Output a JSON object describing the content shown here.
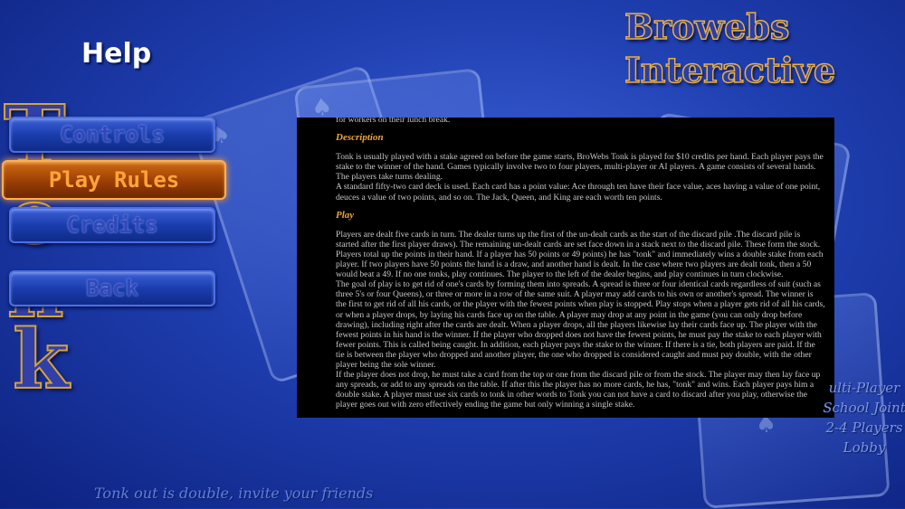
{
  "header": {
    "title": "Help",
    "brand_line1": "Browebs",
    "brand_line2": "Interactive"
  },
  "logo": {
    "letters": [
      "T",
      "o",
      "n",
      "k"
    ]
  },
  "menu": {
    "controls": "Controls",
    "play_rules": "Play Rules",
    "credits": "Credits",
    "back": "Back",
    "active": "Play Rules"
  },
  "content": {
    "top_line": "for workers on their lunch break.",
    "description_heading": "Description",
    "description": [
      "Tonk is usually played with a stake agreed on before the game starts, BroWebs Tonk is played for $10 credits per hand. Each player pays the stake to the winner of the hand. Games typically involve two to four players, multi-player or AI players. A game consists of several hands. The players take turns dealing.",
      "A standard fifty-two card deck is used. Each card has a point value: Ace through ten have their face value, aces having a value of one point, deuces a value of two points, and so on. The Jack, Queen, and King are each worth ten points."
    ],
    "play_heading": "Play",
    "play": [
      "Players are dealt five cards in turn. The dealer turns up the first of the un-dealt cards as the start of the discard pile .The discard pile is started after the first player draws). The remaining un-dealt cards are set face down in a stack next to the discard pile. These form the stock.",
      "Players total up the points in their hand. If a player has 50 points or 49 points) he has \"tonk\" and immediately wins a double stake from each player. If two players have 50 points the hand is a draw, and another hand is dealt. In the case where two players are dealt tonk, then a 50 would beat a 49. If no one tonks, play continues. The player to the left of the dealer begins, and play continues in turn clockwise.",
      "The goal of play is to get rid of one's cards by forming them into spreads. A spread is three or four identical cards regardless of suit (such as three 5's or four Queens), or three or more in a row of the same suit. A player may add cards to his own or another's spread. The winner is the first to get rid of all his cards, or the player with the fewest points when play is stopped. Play stops when a player gets rid of all his cards, or when a player drops, by laying his cards face up on the table. A player may drop at any point in the game (you can only drop before drawing), including right after the cards are dealt. When a player drops, all the players likewise lay their cards face up. The player with the fewest points in his hand is the winner. If the player who dropped does not have the fewest points, he must pay the stake to each player with fewer points. This is called being caught. In addition, each player pays the stake to the winner. If there is a tie, both players are paid. If the tie is between the player who dropped and another player, the one who dropped is considered caught and must pay double, with the other player being the sole winner.",
      "If the player does not drop, he must take a card from the top or one from the discard pile or from the stock. The player may then lay face up any spreads, or add to any spreads on the table. If after this the player has no more cards, he has, \"tonk\" and wins. Each player pays him a double stake. A player must use six cards to tonk in other words to Tonk you can not have a card to discard after you play, otherwise the player goes out with zero effectively ending the game but only winning a single stake."
    ]
  },
  "side_text": [
    "ulti-Player",
    "School Joint",
    "2-4 Players",
    "Lobby"
  ],
  "footer": "Tonk out is double, invite your friends",
  "colors": {
    "background": "#1f3fb0",
    "accent_orange": "#f0a43a",
    "button_blue": "#1a3dad"
  }
}
